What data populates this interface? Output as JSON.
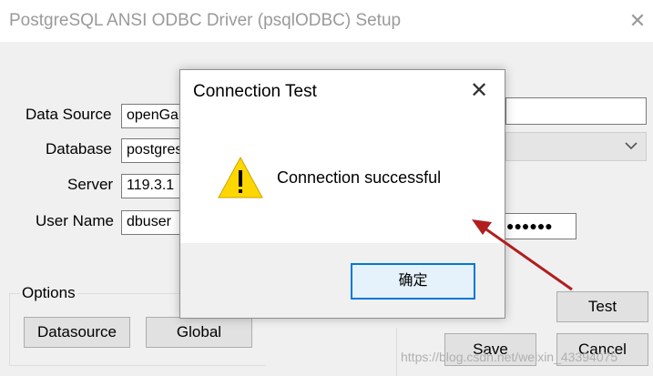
{
  "setup_window": {
    "title": "PostgreSQL ANSI ODBC Driver (psqlODBC) Setup",
    "close_glyph": "✕"
  },
  "form": {
    "data_source_label": "Data Source",
    "data_source_value": "openGa",
    "database_label": "Database",
    "database_value": "postgres",
    "server_label": "Server",
    "server_value": "119.3.1",
    "user_name_label": "User Name",
    "user_name_value": "dbuser",
    "password_masked": "●●●●●●"
  },
  "options": {
    "group_label": "Options",
    "datasource_button": "Datasource",
    "global_button": "Global"
  },
  "buttons": {
    "test": "Test",
    "save": "Save",
    "cancel": "Cancel"
  },
  "dialog": {
    "title": "Connection Test",
    "close_glyph": "✕",
    "message": "Connection successful",
    "ok_button": "确定"
  },
  "watermark": "https://blog.csdn.net/weixin_43394075",
  "colors": {
    "accent": "#0078d7",
    "arrow": "#b01e1e",
    "warning_fill": "#ffd700"
  }
}
